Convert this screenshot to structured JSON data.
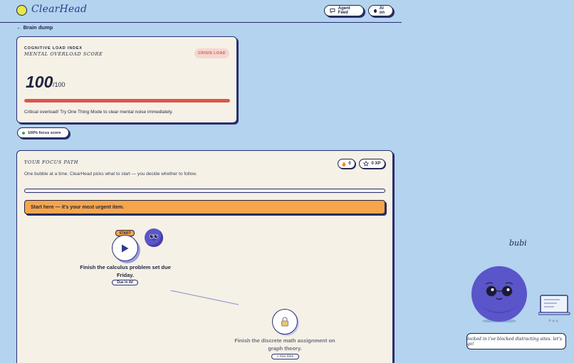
{
  "app": {
    "name": "ClearHead"
  },
  "header": {
    "agent_feed_label": "Agent Feed",
    "ai_toggle_label": "AI on"
  },
  "nav": {
    "back_label": "← Brain dump"
  },
  "cognitive_card": {
    "kicker": "COGNITIVE LOAD INDEX",
    "subtitle": "MENTAL OVERLOAD SCORE",
    "badge": "CRISIS LOAD",
    "score": "100",
    "score_max": "/100",
    "score_fraction": 1.0,
    "message": "Critical overload! Try One Thing Mode to clear mental noise immediately."
  },
  "focus_pill": {
    "label": "100% focus score"
  },
  "focus_path": {
    "title": "YOUR FOCUS PATH",
    "subtitle": "One bubble at a time. ClearHead picks what to start — you decide whether to follow.",
    "streak": "0",
    "xp": "0 XP",
    "progress_fraction": 0,
    "banner": "Start here — it's your most urgent item.",
    "start_tag": "START",
    "tasks": [
      {
        "title": "Finish the calculus problem set due Friday.",
        "due": "Due in 4d",
        "state": "active"
      },
      {
        "title": "Finish the discrete math assignment on graph theory.",
        "due": "+ due date",
        "state": "locked"
      }
    ]
  },
  "mascot": {
    "name": "bubi",
    "message": "locked in i've blocked distracting sites. let's go!"
  },
  "colors": {
    "background": "#b3d3ef",
    "card": "#f6f1e6",
    "accent_orange": "#f7a54a",
    "danger": "#d9574a",
    "mascot": "#5a55c9"
  }
}
